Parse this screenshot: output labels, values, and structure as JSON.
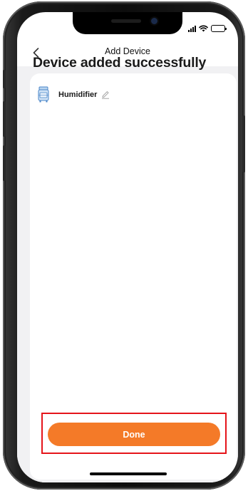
{
  "navigation": {
    "title": "Add Device",
    "back_icon": "chevron-left-icon"
  },
  "status_bar": {
    "icons": [
      "signal-icon",
      "wifi-icon",
      "battery-charging-icon"
    ],
    "battery_color": "#34c759"
  },
  "main": {
    "headline": "Device added successfully",
    "device": {
      "name": "Humidifier",
      "icon": "humidifier-icon",
      "edit_icon": "pencil-icon"
    }
  },
  "footer": {
    "done_label": "Done"
  },
  "colors": {
    "accent": "#f47a28",
    "highlight": "#e5141a",
    "device_icon": "#4a86c8",
    "background": "#f1f1f3"
  }
}
